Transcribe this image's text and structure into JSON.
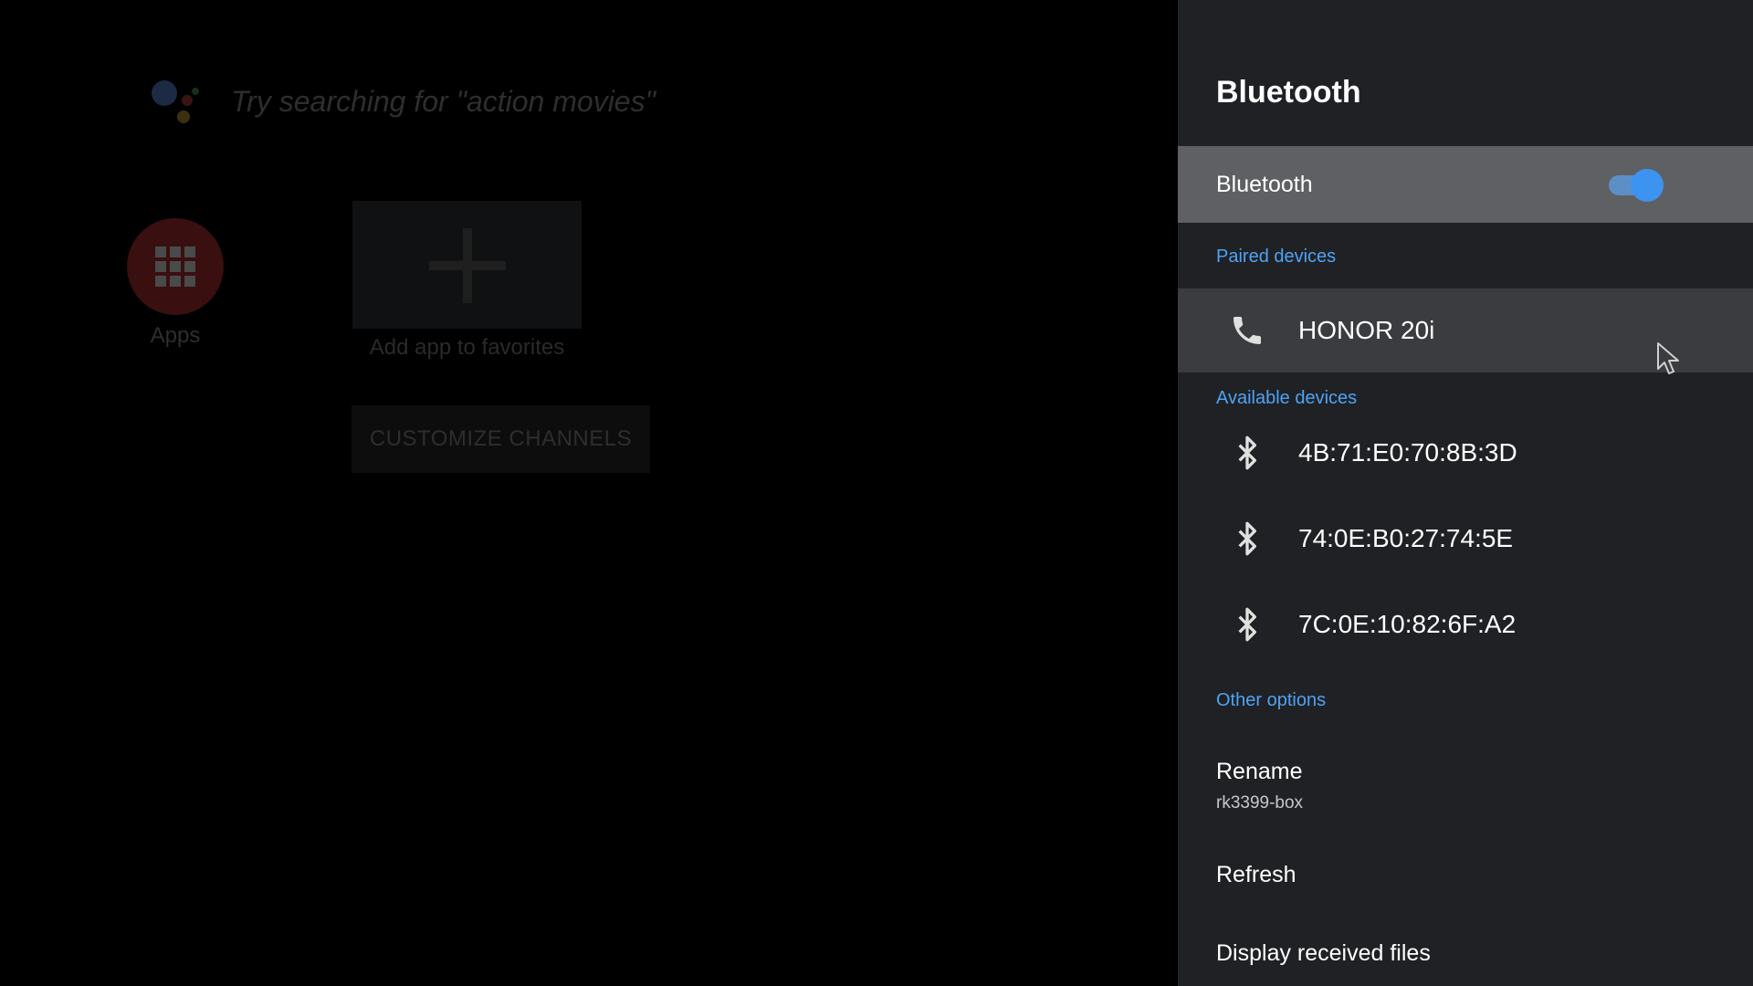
{
  "launcher": {
    "search_hint": "Try searching for \"action movies\"",
    "apps_label": "Apps",
    "add_favorite_label": "Add app to favorites",
    "customize_channels_label": "CUSTOMIZE CHANNELS"
  },
  "panel": {
    "title": "Bluetooth",
    "toggle": {
      "label": "Bluetooth",
      "on": true
    },
    "paired_header": "Paired devices",
    "paired_devices": [
      {
        "name": "HONOR 20i",
        "icon": "phone-icon"
      }
    ],
    "available_header": "Available devices",
    "available_devices": [
      {
        "name": "4B:71:E0:70:8B:3D",
        "icon": "bluetooth-icon"
      },
      {
        "name": "74:0E:B0:27:74:5E",
        "icon": "bluetooth-icon"
      },
      {
        "name": "7C:0E:10:82:6F:A2",
        "icon": "bluetooth-icon"
      }
    ],
    "other_header": "Other options",
    "options": {
      "rename": {
        "title": "Rename",
        "subtitle": "rk3399-box"
      },
      "refresh": {
        "title": "Refresh"
      },
      "received_files": {
        "title": "Display received files"
      }
    }
  },
  "colors": {
    "panel_bg": "#202124",
    "accent": "#4ea3f5",
    "toggle_on": "#3d93f0"
  }
}
